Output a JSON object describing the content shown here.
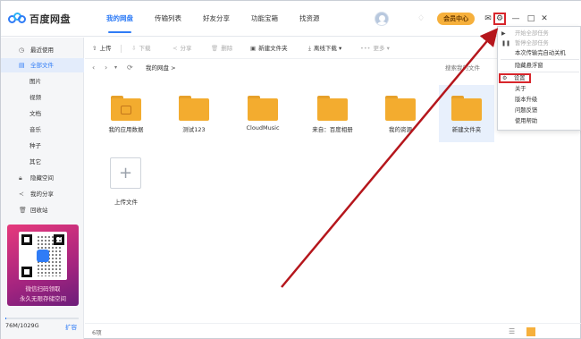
{
  "app": {
    "name": "百度网盘"
  },
  "nav": {
    "tabs": [
      {
        "label": "我的网盘"
      },
      {
        "label": "传输列表"
      },
      {
        "label": "好友分享"
      },
      {
        "label": "功能宝箱"
      },
      {
        "label": "找资源"
      }
    ],
    "active_tab": "我的网盘"
  },
  "user": {
    "vip_button": "会员中心"
  },
  "sidebar": {
    "items": [
      {
        "label": "最近使用",
        "icon": "clock-icon"
      },
      {
        "label": "全部文件",
        "icon": "files-icon"
      },
      {
        "label": "图片"
      },
      {
        "label": "视频"
      },
      {
        "label": "文档"
      },
      {
        "label": "音乐"
      },
      {
        "label": "种子"
      },
      {
        "label": "其它"
      },
      {
        "label": "隐藏空间",
        "icon": "lock-icon"
      },
      {
        "label": "我的分享",
        "icon": "share-icon"
      },
      {
        "label": "回收站",
        "icon": "trash-icon"
      }
    ],
    "promo": {
      "line1": "微信扫码领取",
      "line2": "永久无限存储空间"
    },
    "storage": {
      "text": "76M/1029G",
      "expand": "扩容",
      "used_fraction": 0.0001
    }
  },
  "toolbar": {
    "upload": "上传",
    "download": "下载",
    "share": "分享",
    "delete": "删除",
    "new_folder": "新建文件夹",
    "offline": "离线下载",
    "more": "更多"
  },
  "path": {
    "current": "我的网盘",
    "search_placeholder": "搜索我的文件"
  },
  "files": [
    {
      "name": "我的应用数据",
      "type": "app-folder"
    },
    {
      "name": "测试123",
      "type": "folder"
    },
    {
      "name": "CloudMusic",
      "type": "folder"
    },
    {
      "name": "来自：百度相册",
      "type": "folder"
    },
    {
      "name": "我的资源",
      "type": "folder"
    },
    {
      "name": "新建文件夹",
      "type": "folder",
      "selected": true
    }
  ],
  "upload_tile": {
    "label": "上传文件"
  },
  "status": {
    "count": "6项"
  },
  "settings_menu": {
    "items": [
      {
        "label": "开始全部任务",
        "disabled": true,
        "icon": "play-icon"
      },
      {
        "label": "暂停全部任务",
        "disabled": true,
        "icon": "pause-icon"
      },
      {
        "label": "本次传输完自动关机"
      },
      {
        "label": "隐藏悬浮窗"
      },
      {
        "label": "设置",
        "icon": "settings-icon",
        "highlighted": true
      },
      {
        "label": "关于"
      },
      {
        "label": "版本升级"
      },
      {
        "label": "问题反馈"
      },
      {
        "label": "使用帮助"
      }
    ]
  },
  "colors": {
    "accent": "#2f7cf6",
    "folder": "#f3ac2f",
    "highlight": "#d8262c",
    "vip": "#f6b03c"
  }
}
